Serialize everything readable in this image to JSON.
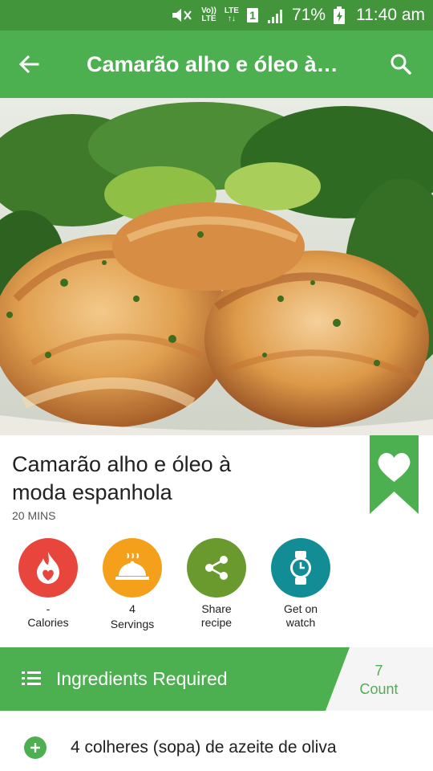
{
  "status_bar": {
    "volte_top": "Vo))",
    "volte_bottom": "LTE",
    "lte_top": "LTE",
    "lte_bottom": "↑↓",
    "sim": "1",
    "battery": "71%",
    "time": "11:40 am"
  },
  "app_bar": {
    "title": "Camarão alho e óleo à…"
  },
  "recipe": {
    "title": "Camarão alho e óleo à moda espanhola",
    "time": "20 MINS"
  },
  "actions": [
    {
      "line1": "-",
      "line2": "Calories",
      "color": "#e8453c",
      "icon": "calories-icon"
    },
    {
      "line1": "4",
      "line2": "Servings",
      "color": "#f5a01a",
      "icon": "servings-icon"
    },
    {
      "line1": "Share",
      "line2": "recipe",
      "color": "#6a9a2e",
      "icon": "share-icon"
    },
    {
      "line1": "Get on",
      "line2": "watch",
      "color": "#128c95",
      "icon": "watch-icon"
    }
  ],
  "ingredients": {
    "header": "Ingredients Required",
    "count": "7",
    "count_label": "Count",
    "items": [
      "4 colheres (sopa) de azeite de oliva"
    ]
  },
  "colors": {
    "primary": "#4caf50",
    "primary_dark": "#43953c"
  }
}
